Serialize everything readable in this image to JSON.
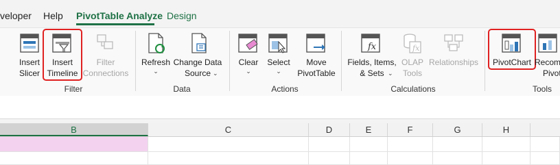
{
  "tabs": [
    {
      "label": "veloper"
    },
    {
      "label": "Help"
    },
    {
      "label": "PivotTable Analyze"
    },
    {
      "label": "Design"
    }
  ],
  "ribbon": {
    "groups": {
      "filter": {
        "label": "Filter",
        "insert_slicer": [
          "Insert",
          "Slicer"
        ],
        "insert_timeline": [
          "Insert",
          "Timeline"
        ],
        "filter_connections": [
          "Filter",
          "Connections"
        ]
      },
      "data": {
        "label": "Data",
        "refresh": "Refresh",
        "change_data_source": [
          "Change Data",
          "Source"
        ]
      },
      "actions": {
        "label": "Actions",
        "clear": "Clear",
        "select": "Select",
        "move_pivottable": [
          "Move",
          "PivotTable"
        ]
      },
      "calculations": {
        "label": "Calculations",
        "fields_items_sets": [
          "Fields, Items,",
          "& Sets"
        ],
        "olap_tools": [
          "OLAP",
          "Tools"
        ],
        "relationships": "Relationships"
      },
      "tools": {
        "label": "Tools",
        "pivotchart": "PivotChart",
        "recommended": [
          "Recom",
          "Pivot"
        ]
      }
    }
  },
  "columns": [
    "B",
    "C",
    "D",
    "E",
    "F",
    "G",
    "H"
  ],
  "colors": {
    "accent_green": "#1e7145",
    "highlight_red": "#e02020",
    "selected_fill": "#f3d2ef"
  }
}
